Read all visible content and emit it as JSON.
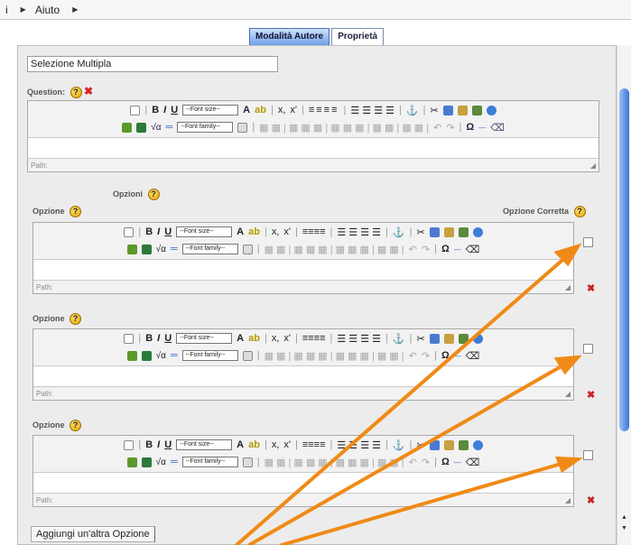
{
  "menu": {
    "left_item": "i",
    "help": "Aiuto"
  },
  "tabs": [
    {
      "label": "Modalità Autore"
    },
    {
      "label": "Proprietà"
    }
  ],
  "title_value": "Selezione Multipla",
  "question_label": "Question:",
  "opzioni_label": "Opzioni",
  "opzione_label": "Opzione",
  "corretta_label": "Opzione Corretta",
  "toolbar": {
    "fontsize": "--Font size--",
    "fontfamily": "--Font family--",
    "omega": "Ω"
  },
  "path_label": "Path:",
  "options": [
    {
      "label": "Opzione"
    },
    {
      "label": "Opzione"
    },
    {
      "label": "Opzione"
    }
  ],
  "add_button": "Aggiungi un'altra Opzione",
  "colors": {
    "arrow": "#f08a16",
    "tab_active": "#6fa0e8",
    "scroll_thumb": "#3a76d4"
  }
}
